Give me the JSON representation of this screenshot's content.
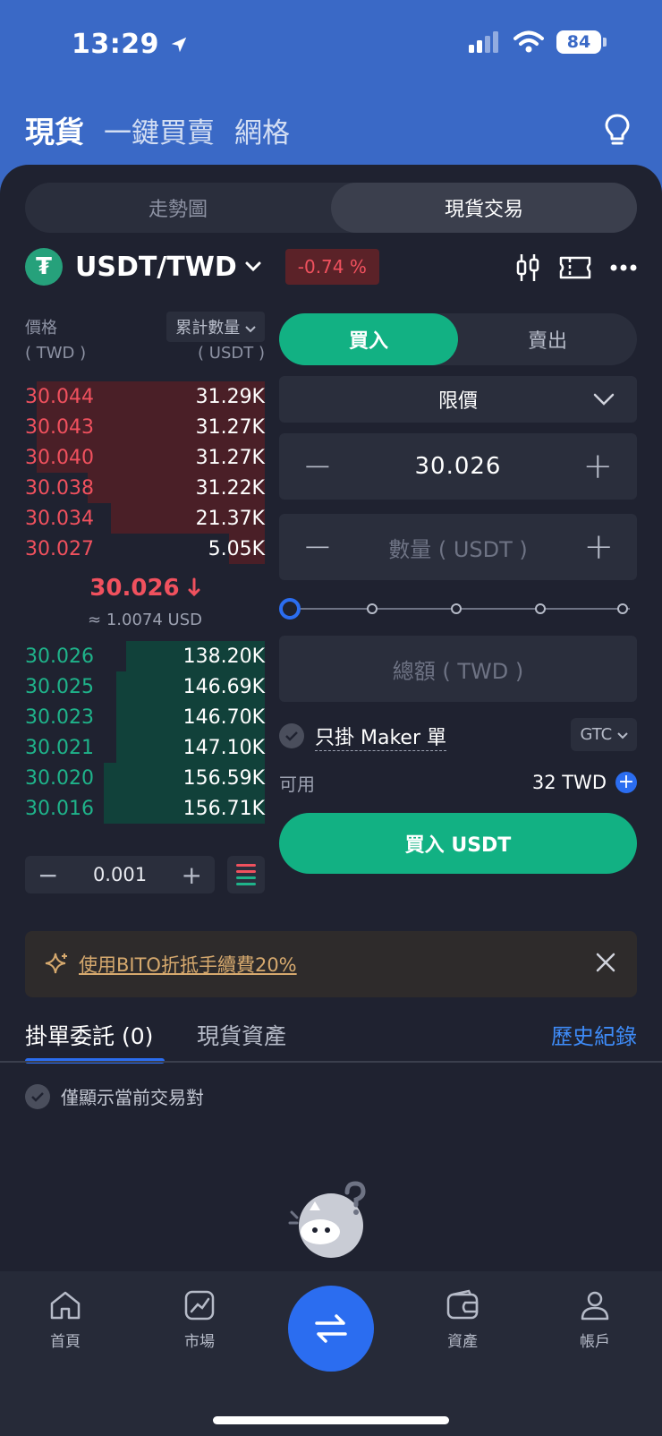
{
  "status": {
    "time": "13:29",
    "battery": "84"
  },
  "top_tabs": [
    "現貨",
    "一鍵買賣",
    "網格"
  ],
  "segment": [
    "走勢圖",
    "現貨交易"
  ],
  "pair": {
    "symbol": "USDT/TWD",
    "change": "-0.74 %"
  },
  "orderbook": {
    "price_label": "價格",
    "price_unit": "( TWD )",
    "qty_label": "累計數量",
    "qty_unit": "( USDT )",
    "asks": [
      {
        "price": "30.044",
        "amount": "31.29K",
        "depth_pct": 95
      },
      {
        "price": "30.043",
        "amount": "31.27K",
        "depth_pct": 95
      },
      {
        "price": "30.040",
        "amount": "31.27K",
        "depth_pct": 95
      },
      {
        "price": "30.038",
        "amount": "31.22K",
        "depth_pct": 74
      },
      {
        "price": "30.034",
        "amount": "21.37K",
        "depth_pct": 64
      },
      {
        "price": "30.027",
        "amount": "5.05K",
        "depth_pct": 15
      }
    ],
    "last_price": "30.026",
    "last_usd": "≈ 1.0074 USD",
    "bids": [
      {
        "price": "30.026",
        "amount": "138.20K",
        "depth_pct": 58
      },
      {
        "price": "30.025",
        "amount": "146.69K",
        "depth_pct": 62
      },
      {
        "price": "30.023",
        "amount": "146.70K",
        "depth_pct": 62
      },
      {
        "price": "30.021",
        "amount": "147.10K",
        "depth_pct": 62
      },
      {
        "price": "30.020",
        "amount": "156.59K",
        "depth_pct": 67
      },
      {
        "price": "30.016",
        "amount": "156.71K",
        "depth_pct": 67
      }
    ],
    "step": "0.001"
  },
  "trade": {
    "buy_tab": "買入",
    "sell_tab": "賣出",
    "order_type": "限價",
    "price_value": "30.026",
    "qty_placeholder": "數量 ( USDT )",
    "total_placeholder": "總額 ( TWD )",
    "slider_marks": [
      "0",
      "0",
      "0",
      "0"
    ],
    "maker_label": "只掛 Maker 單",
    "tif": "GTC",
    "avail_label": "可用",
    "avail_value": "32 TWD",
    "buy_button": "買入 USDT"
  },
  "promo": {
    "text": "使用BITO折抵手續費20%"
  },
  "orders_tabs": {
    "open": "掛單委託 (0)",
    "assets": "現貨資產",
    "history": "歷史紀錄"
  },
  "only_current": "僅顯示當前交易對",
  "bottom_nav": [
    "首頁",
    "市場",
    "資產",
    "帳戶"
  ],
  "colors": {
    "buy": "#12b183",
    "sell": "#f0515e",
    "accent": "#2b6df0",
    "header": "#3a69c6"
  }
}
